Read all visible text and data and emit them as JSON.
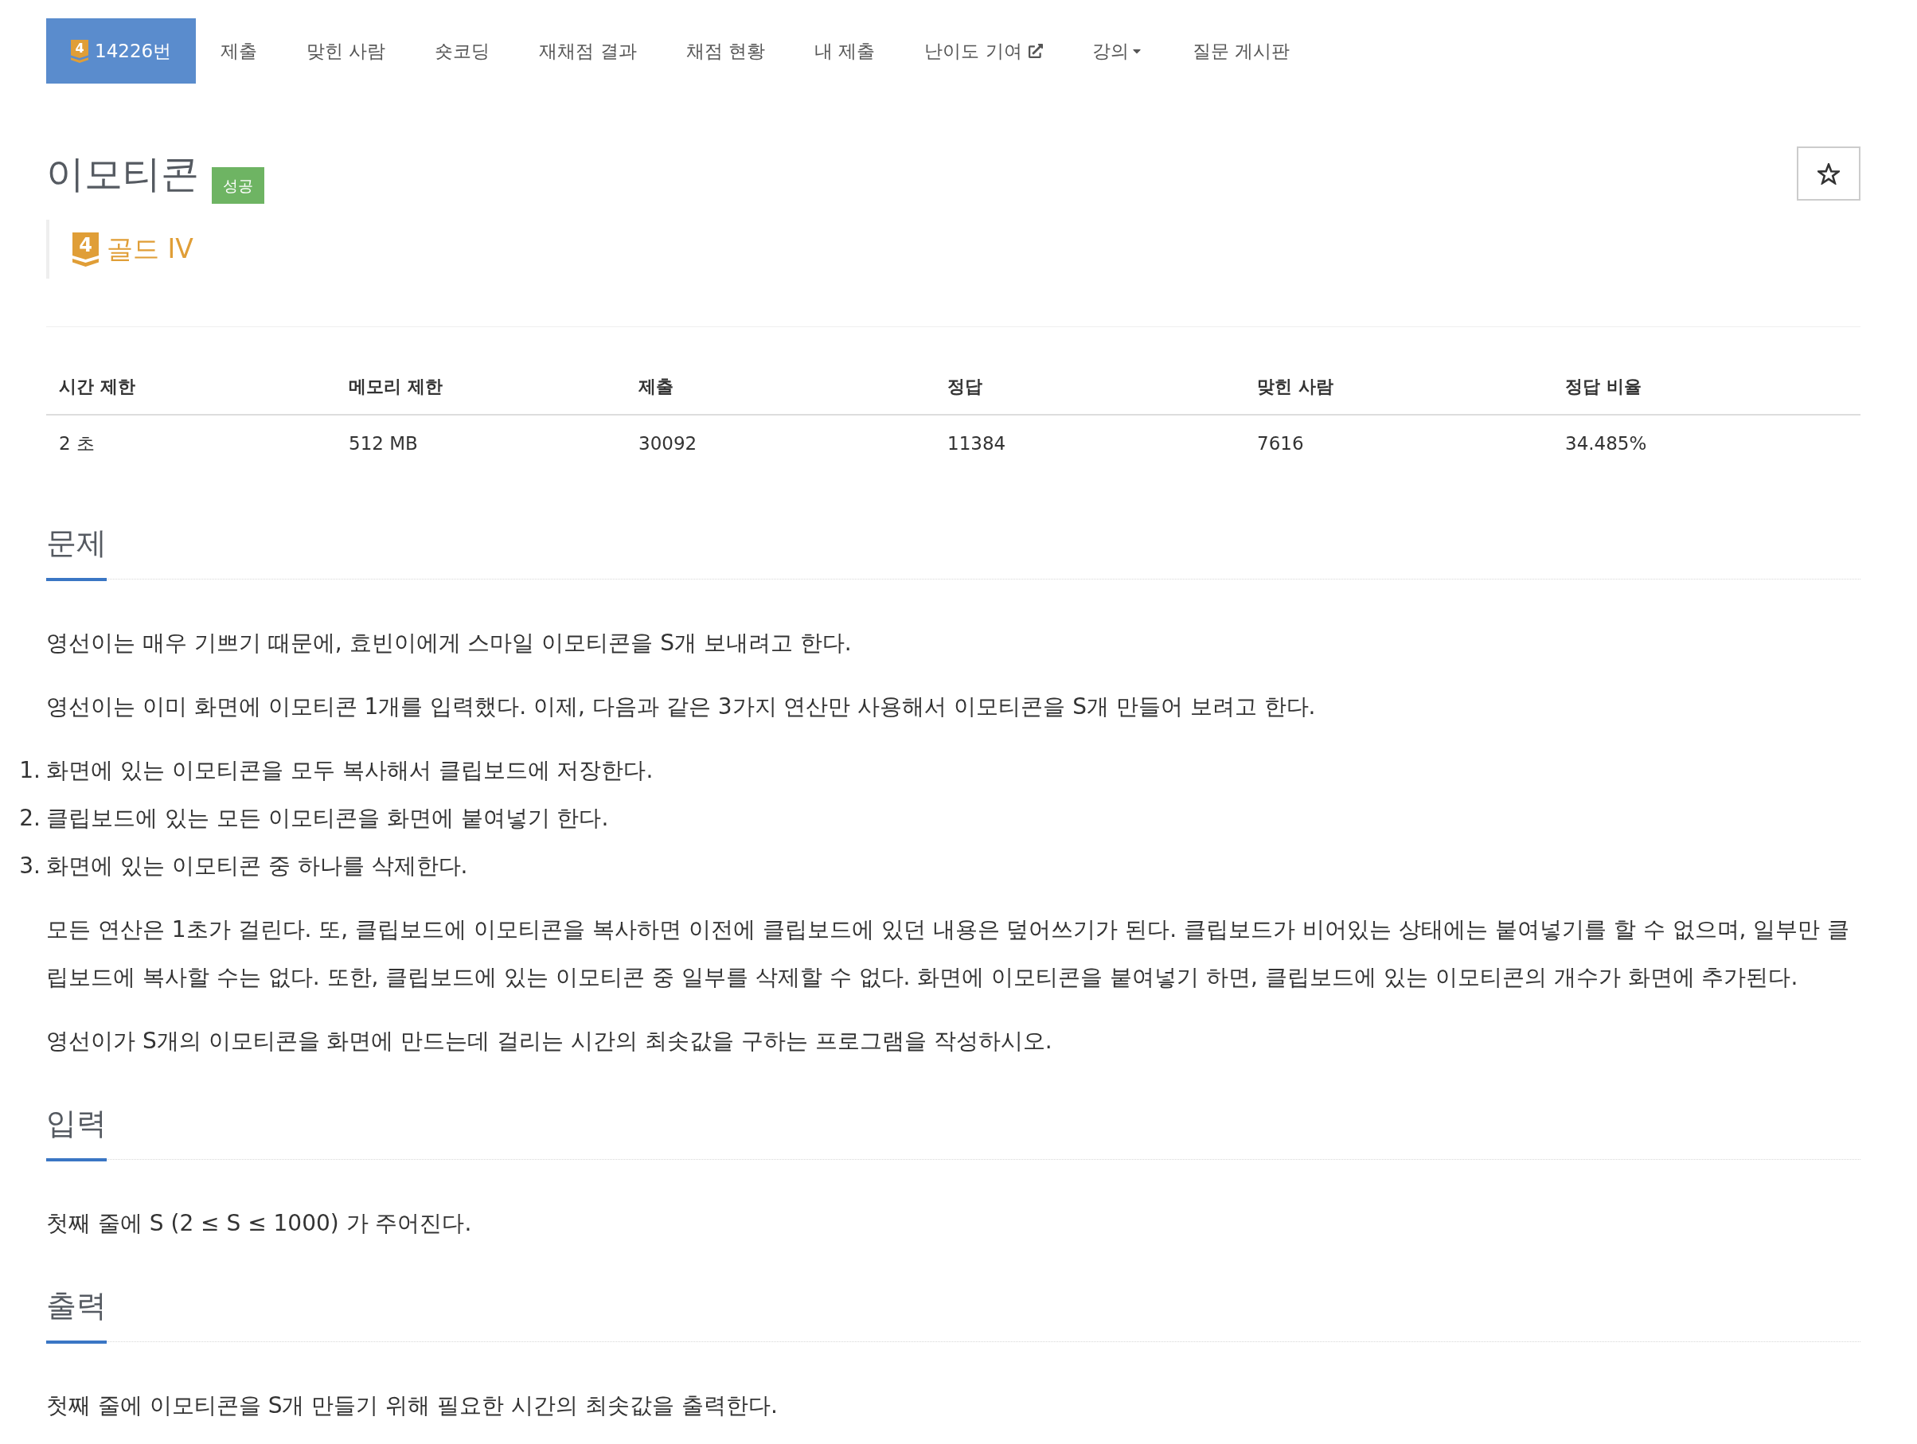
{
  "nav": {
    "items": [
      {
        "kind": "problem",
        "badge": "4",
        "label": "14226번",
        "selected": true
      },
      {
        "kind": "link",
        "label": "제출",
        "selected": false
      },
      {
        "kind": "link",
        "label": "맞힌 사람",
        "selected": false
      },
      {
        "kind": "link",
        "label": "숏코딩",
        "selected": false
      },
      {
        "kind": "link",
        "label": "재채점 결과",
        "selected": false
      },
      {
        "kind": "link",
        "label": "채점 현황",
        "selected": false
      },
      {
        "kind": "link",
        "label": "내 제출",
        "selected": false
      },
      {
        "kind": "external",
        "label": "난이도 기여",
        "selected": false
      },
      {
        "kind": "dropdown",
        "label": "강의",
        "selected": false
      },
      {
        "kind": "link",
        "label": "질문 게시판",
        "selected": false
      }
    ]
  },
  "problem": {
    "title": "이모티콘",
    "result_badge": "성공",
    "starred": false,
    "tier": {
      "badge": "4",
      "label": "골드 IV"
    }
  },
  "table": {
    "columns": [
      "시간 제한",
      "메모리 제한",
      "제출",
      "정답",
      "맞힌 사람",
      "정답 비율"
    ],
    "rows": [
      [
        "2 초",
        "512 MB",
        "30092",
        "11384",
        "7616",
        "34.485%"
      ]
    ]
  },
  "sections": [
    {
      "heading": "문제",
      "blocks": [
        {
          "kind": "paragraph",
          "text": "영선이는 매우 기쁘기 때문에, 효빈이에게 스마일 이모티콘을 S개 보내려고 한다."
        },
        {
          "kind": "paragraph",
          "text": "영선이는 이미 화면에 이모티콘 1개를 입력했다. 이제, 다음과 같은 3가지 연산만 사용해서 이모티콘을 S개 만들어 보려고 한다."
        },
        {
          "kind": "ordered_list",
          "items": [
            {
              "number": "1.",
              "text": "화면에 있는 이모티콘을 모두 복사해서 클립보드에 저장한다."
            },
            {
              "number": "2.",
              "text": "클립보드에 있는 모든 이모티콘을 화면에 붙여넣기 한다."
            },
            {
              "number": "3.",
              "text": "화면에 있는 이모티콘 중 하나를 삭제한다."
            }
          ]
        },
        {
          "kind": "paragraph",
          "text": "모든 연산은 1초가 걸린다. 또, 클립보드에 이모티콘을 복사하면 이전에 클립보드에 있던 내용은 덮어쓰기가 된다. 클립보드가 비어있는 상태에는 붙여넣기를 할 수 없으며, 일부만 클립보드에 복사할 수는 없다. 또한, 클립보드에 있는 이모티콘 중 일부를 삭제할 수 없다. 화면에 이모티콘을 붙여넣기 하면, 클립보드에 있는 이모티콘의 개수가 화면에 추가된다."
        },
        {
          "kind": "paragraph",
          "text": "영선이가 S개의 이모티콘을 화면에 만드는데 걸리는 시간의 최솟값을 구하는 프로그램을 작성하시오."
        }
      ]
    },
    {
      "heading": "입력",
      "blocks": [
        {
          "kind": "paragraph",
          "text": "첫째 줄에 S (2 ≤ S ≤ 1000) 가 주어진다."
        }
      ]
    },
    {
      "heading": "출력",
      "blocks": [
        {
          "kind": "paragraph",
          "text": "첫째 줄에 이모티콘을 S개 만들기 위해 필요한 시간의 최솟값을 출력한다."
        }
      ]
    }
  ]
}
